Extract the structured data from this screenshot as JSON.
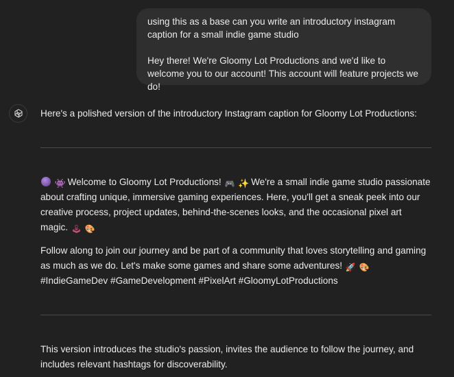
{
  "user_message": {
    "line1": "using this as a base can you write an introductory instagram caption for a small indie game studio",
    "line2": "Hey there! We're Gloomy Lot Productions and we'd like to welcome you to our account! This account will feature projects we do!"
  },
  "assistant_message": {
    "avatar_icon": "openai-logo-icon",
    "intro": "Here's a polished version of the introductory Instagram caption for Gloomy Lot Productions:",
    "caption_p1_a": "Welcome to Gloomy Lot Productions!",
    "caption_p1_b": "We're a small indie game studio passionate about crafting unique, immersive gaming experiences. Here, you'll get a sneak peek into our creative process, project updates, behind-the-scenes looks, and the occasional pixel art magic.",
    "caption_p2_a": "Follow along to join our journey and be part of a community that loves storytelling and gaming as much as we do. Let's make some games and share some adventures!",
    "caption_p2_b": "#IndieGameDev #GameDevelopment #PixelArt #GloomyLotProductions",
    "outro": "This version introduces the studio's passion, invites the audience to follow the journey, and includes relevant hashtags for discoverability."
  },
  "emojis": {
    "crystal_ball": "🔮",
    "alien_monster": "👾",
    "video_game": "🎮",
    "sparkles": "✨",
    "joystick": "🕹️",
    "artist": "👩‍🎨",
    "rocket": "🚀",
    "palette": "🎨"
  },
  "colors": {
    "background": "#212121",
    "user_bubble": "#2f2f2f",
    "text": "#ececec",
    "divider": "#4a4a4a"
  }
}
